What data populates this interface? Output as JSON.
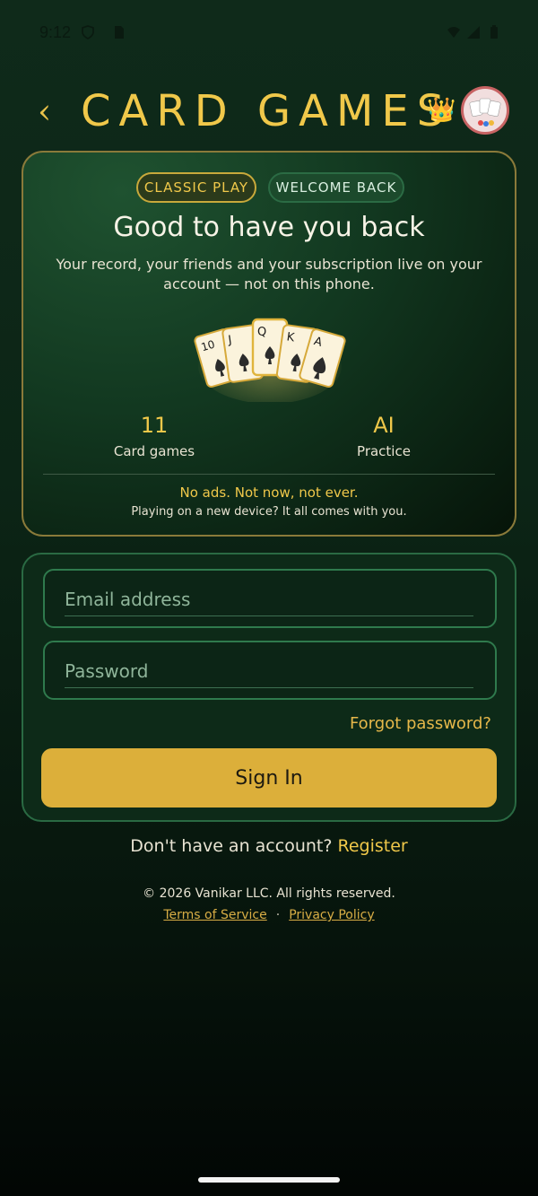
{
  "status_bar": {
    "time": "9:12"
  },
  "header": {
    "back_glyph": "‹",
    "title": "CARD GAMES",
    "crown": "👑"
  },
  "hero": {
    "chips": [
      "CLASSIC PLAY",
      "WELCOME BACK"
    ],
    "title": "Good to have you back",
    "subtitle": "Your record, your friends and your subscription live on your account — not on this phone.",
    "cards": [
      "10",
      "J",
      "Q",
      "K",
      "A"
    ],
    "stats": [
      {
        "value": "11",
        "label": "Card games"
      },
      {
        "value": "AI",
        "label": "Practice"
      }
    ],
    "promo_title": "No ads. Not now, not ever.",
    "promo_sub": "Playing on a new device? It all comes with you."
  },
  "form": {
    "email_placeholder": "Email address",
    "password_placeholder": "Password",
    "forgot_label": "Forgot password?",
    "signin_label": "Sign In"
  },
  "footer": {
    "register_prompt": "Don't have an account?",
    "register_label": "Register",
    "copyright": "© 2026 Vanikar LLC. All rights reserved.",
    "terms_label": "Terms of Service",
    "separator": "·",
    "privacy_label": "Privacy Policy"
  },
  "colors": {
    "accent_gold": "#f0c84a",
    "button_gold": "#dcaf3a",
    "felt_green": "#0d2a18"
  }
}
